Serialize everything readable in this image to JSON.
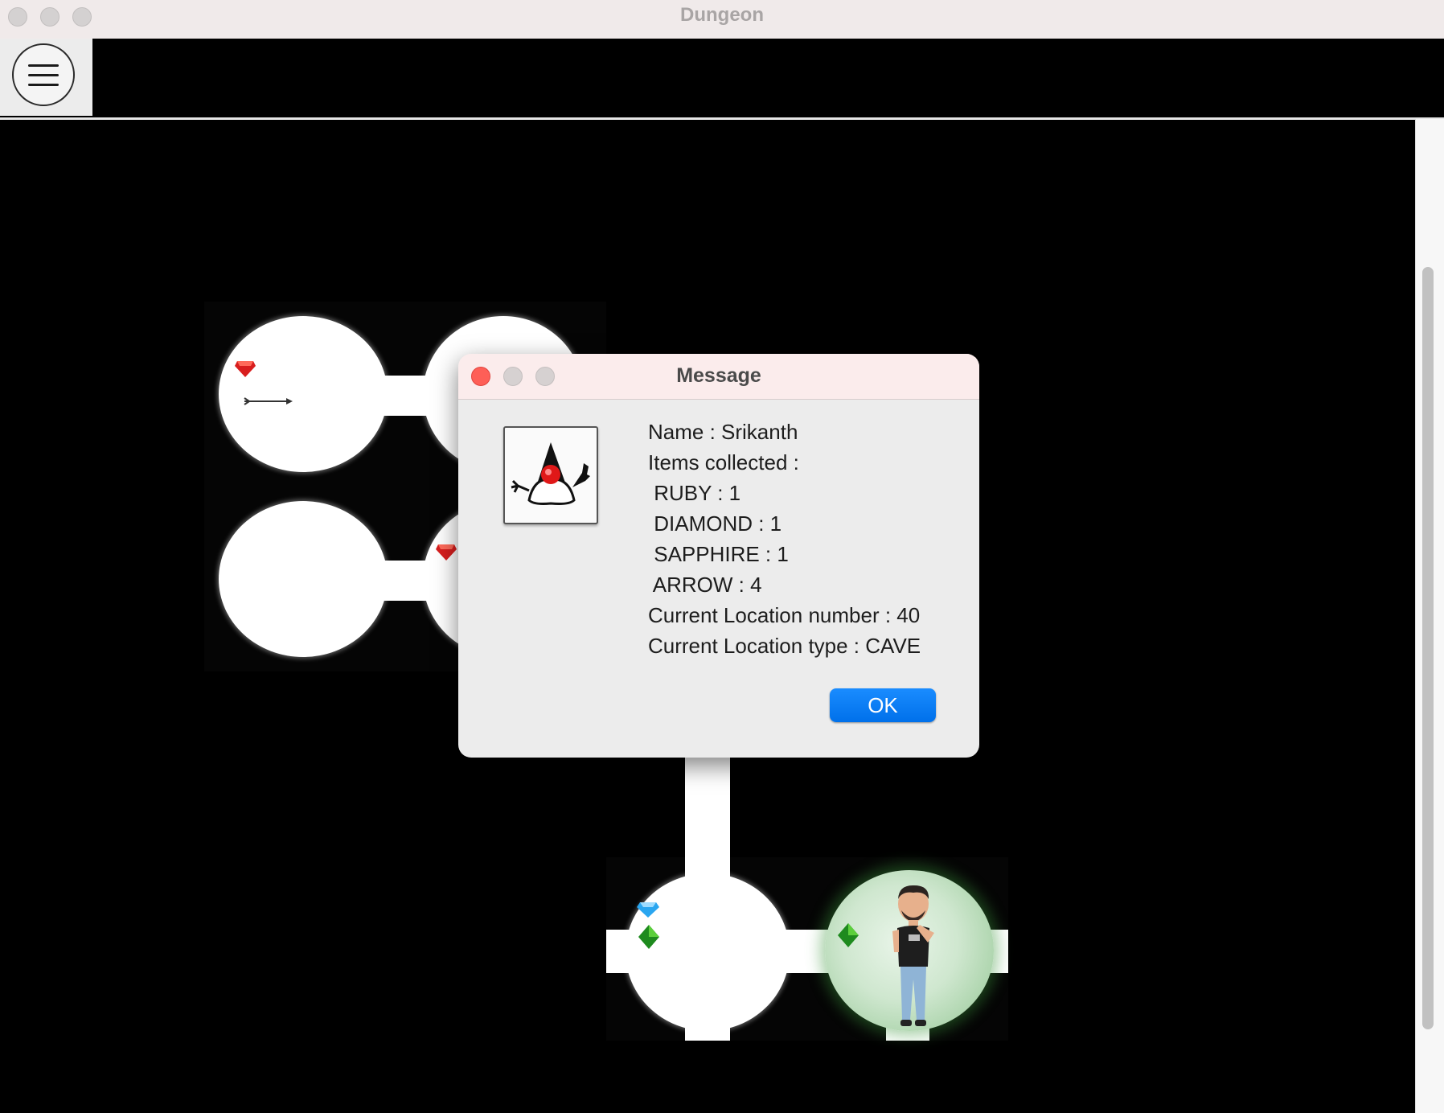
{
  "window": {
    "title": "Dungeon"
  },
  "toolbar": {
    "menu_icon": "hamburger-menu-icon"
  },
  "dialog": {
    "title": "Message",
    "icon": "java-duke-icon",
    "lines": [
      "Name : Srikanth",
      "Items collected :",
      " RUBY : 1",
      " DIAMOND : 1",
      " SAPPHIRE : 1",
      " ARROW : 4",
      "Current Location number : 40",
      "Current Location type : CAVE"
    ],
    "ok_label": "OK"
  },
  "colors": {
    "close": "#fe5f57",
    "ok_button": "#0a7cf5",
    "map_background": "#000000"
  }
}
